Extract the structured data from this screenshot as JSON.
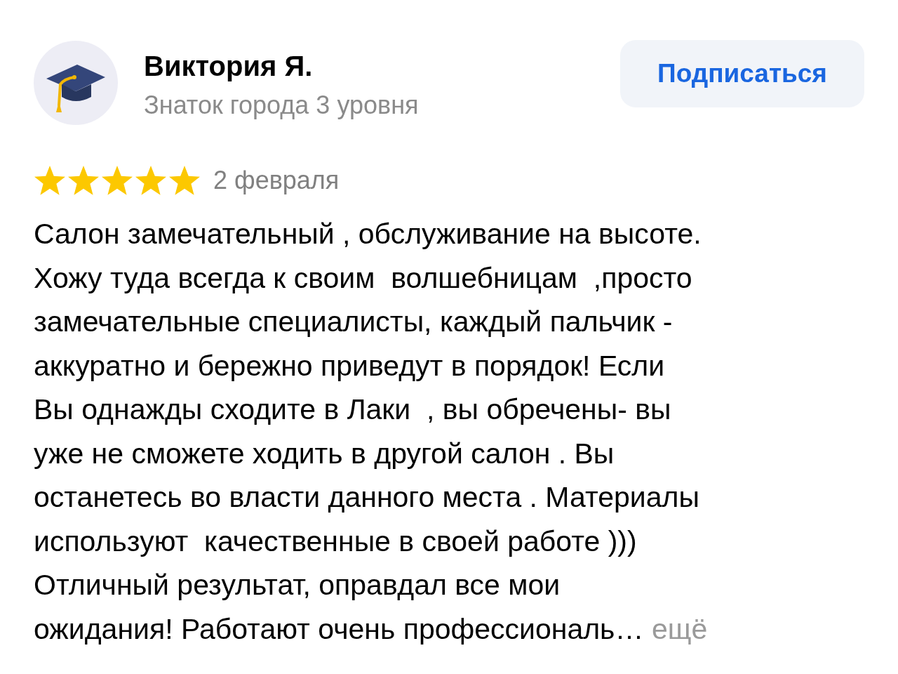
{
  "author": {
    "name": "Виктория Я.",
    "subtitle": "Знаток города 3 уровня"
  },
  "subscribe_button": {
    "label": "Подписаться"
  },
  "review": {
    "stars": 5,
    "date": "2 февраля",
    "text_lines": [
      "Салон замечательный , обслуживание на высоте.",
      "Хожу туда всегда к своим  волшебницам  ,просто",
      "замечательные специалисты, каждый пальчик -",
      "аккуратно и бережно приведут в порядок! Если",
      "Вы однажды сходите в Лаки  , вы обречены- вы",
      "уже не сможете ходить в другой салон . Вы",
      "останетесь во власти данного места . Материалы",
      "используют  качественные в своей работе )))",
      "Отличный результат, оправдал все мои",
      "ожидания! Работают очень профессиональ…"
    ],
    "more_link": "ещё"
  }
}
